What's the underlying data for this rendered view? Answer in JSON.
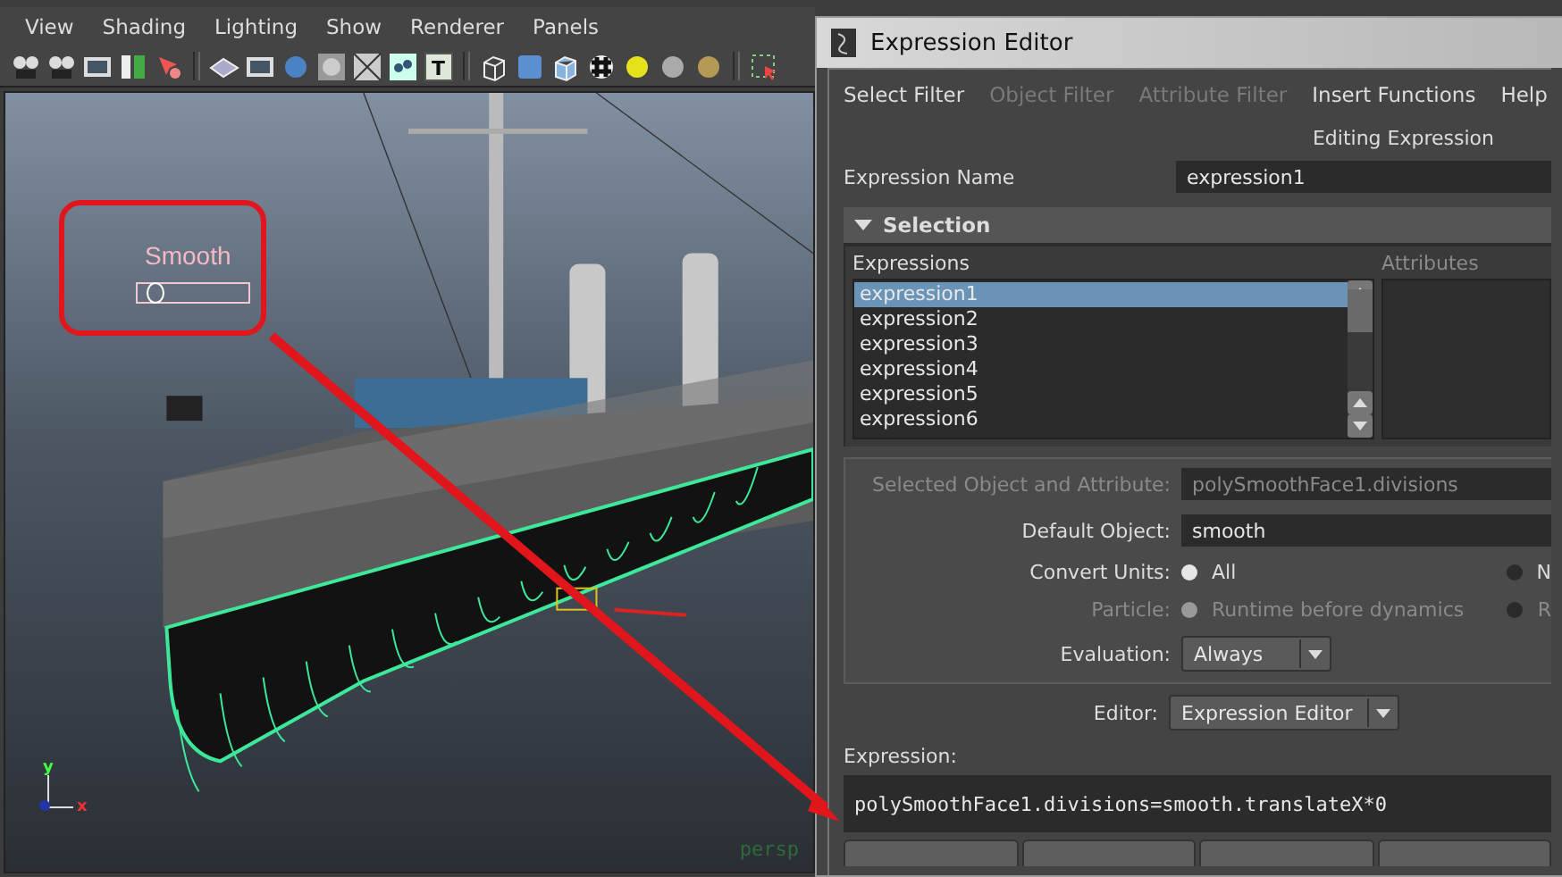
{
  "viewport": {
    "menu": [
      "View",
      "Shading",
      "Lighting",
      "Show",
      "Renderer",
      "Panels"
    ],
    "slider": {
      "label": "Smooth",
      "level": 0.1
    },
    "axis": {
      "y": "y",
      "x": "x"
    },
    "camera_label": "persp",
    "toolbar_text_icon": "T"
  },
  "editor": {
    "title": "Expression Editor",
    "menu": [
      {
        "label": "Select Filter",
        "disabled": false
      },
      {
        "label": "Object Filter",
        "disabled": true
      },
      {
        "label": "Attribute Filter",
        "disabled": true
      },
      {
        "label": "Insert Functions",
        "disabled": false
      },
      {
        "label": "Help",
        "disabled": false
      }
    ],
    "mode": "Editing Expression",
    "expression_name": {
      "label": "Expression Name",
      "value": "expression1"
    },
    "section": {
      "label": "Selection",
      "expanded": true
    },
    "expressions": {
      "label": "Expressions",
      "items": [
        {
          "label": "expression1",
          "selected": true
        },
        {
          "label": "expression2",
          "selected": false
        },
        {
          "label": "expression3",
          "selected": false
        },
        {
          "label": "expression4",
          "selected": false
        },
        {
          "label": "expression5",
          "selected": false
        },
        {
          "label": "expression6",
          "selected": false
        }
      ]
    },
    "attributes": {
      "label": "Attributes"
    },
    "selected_object": {
      "label": "Selected Object and Attribute:",
      "value": "polySmoothFace1.divisions",
      "disabled": true
    },
    "default_object": {
      "label": "Default Object:",
      "value": "smooth",
      "disabled": false
    },
    "convert_units": {
      "label": "Convert Units:",
      "disabled": false,
      "options": [
        {
          "label": "All",
          "selected": true
        },
        {
          "label": "N",
          "selected": false
        }
      ]
    },
    "particle": {
      "label": "Particle:",
      "disabled": true,
      "options": [
        {
          "label": "Runtime before dynamics",
          "selected": true
        },
        {
          "label": "R",
          "selected": false
        }
      ]
    },
    "evaluation": {
      "label": "Evaluation:",
      "value": "Always"
    },
    "editor_select": {
      "label": "Editor:",
      "value": "Expression Editor"
    },
    "expression": {
      "label": "Expression:",
      "code": "polySmoothFace1.divisions=smooth.translateX*0"
    }
  }
}
